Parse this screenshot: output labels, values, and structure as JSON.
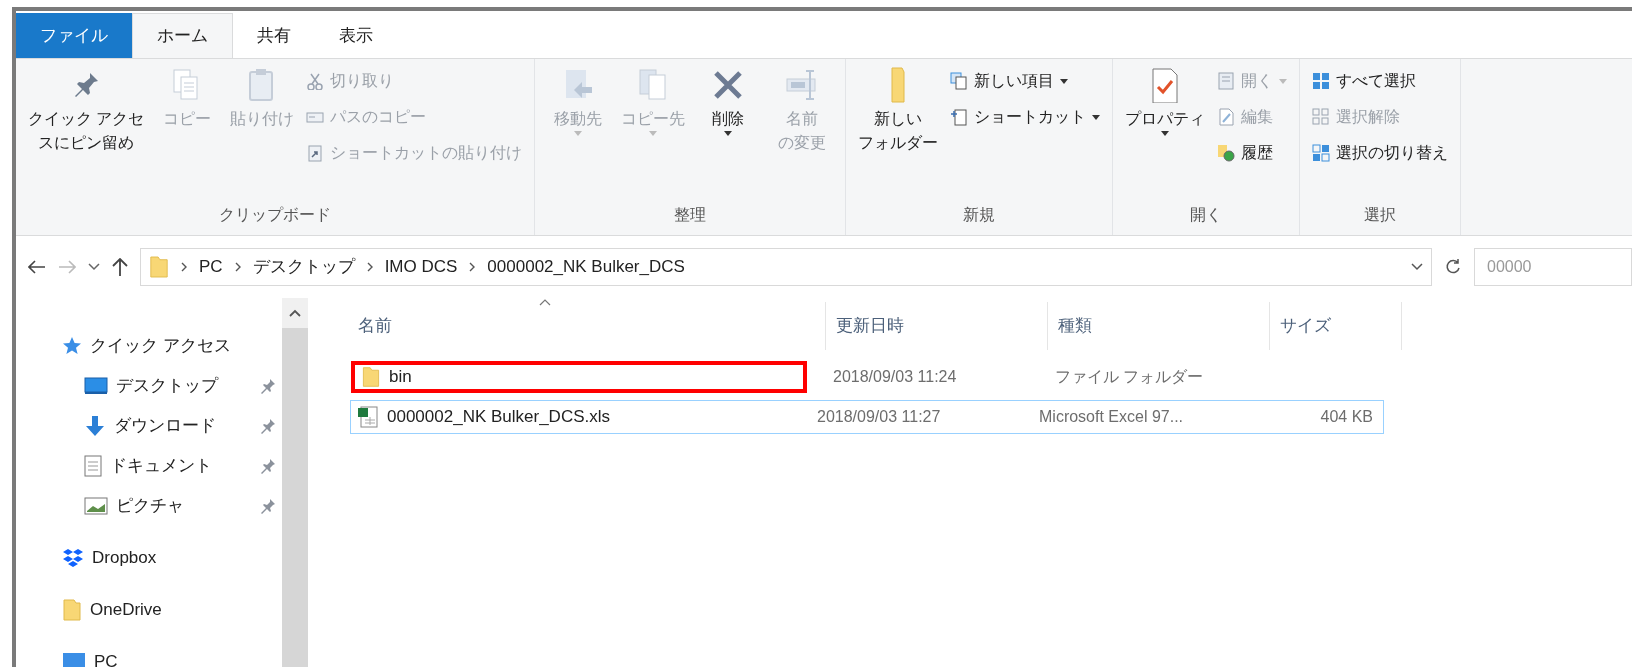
{
  "tabs": [
    {
      "label": "ファイル",
      "kind": "file",
      "selected": false
    },
    {
      "label": "ホーム",
      "kind": "tab",
      "selected": true
    },
    {
      "label": "共有",
      "kind": "tab",
      "selected": false
    },
    {
      "label": "表示",
      "kind": "tab",
      "selected": false
    }
  ],
  "ribbon": [
    {
      "label": "クリップボード",
      "items": [
        {
          "kind": "large",
          "lines": [
            "クイック アクセ",
            "スにピン留め"
          ],
          "disabled": false,
          "dropdown": false
        },
        {
          "kind": "large",
          "label": "コピー",
          "disabled": true,
          "dropdown": false
        },
        {
          "kind": "large",
          "label": "貼り付け",
          "disabled": true,
          "dropdown": false
        },
        {
          "kind": "small",
          "label": "切り取り",
          "disabled": true,
          "dropdown": false
        },
        {
          "kind": "small",
          "label": "パスのコピー",
          "disabled": true,
          "dropdown": false
        },
        {
          "kind": "small",
          "label": "ショートカットの貼り付け",
          "disabled": true,
          "dropdown": false
        }
      ]
    },
    {
      "label": "整理",
      "items": [
        {
          "kind": "large",
          "label": "移動先",
          "disabled": true,
          "dropdown": true
        },
        {
          "kind": "large",
          "label": "コピー先",
          "disabled": true,
          "dropdown": true
        },
        {
          "kind": "large",
          "label": "削除",
          "disabled": false,
          "dropdown": true
        },
        {
          "kind": "large",
          "lines": [
            "名前",
            "の変更"
          ],
          "disabled": true,
          "dropdown": false
        }
      ]
    },
    {
      "label": "新規",
      "items": [
        {
          "kind": "large",
          "lines": [
            "新しい",
            "フォルダー"
          ],
          "disabled": false,
          "dropdown": false
        },
        {
          "kind": "small",
          "label": "新しい項目",
          "disabled": false,
          "dropdown": true
        },
        {
          "kind": "small",
          "label": "ショートカット",
          "disabled": false,
          "dropdown": true
        }
      ]
    },
    {
      "label": "開く",
      "items": [
        {
          "kind": "large",
          "label": "プロパティ",
          "disabled": false,
          "dropdown": true
        },
        {
          "kind": "small",
          "label": "開く",
          "disabled": true,
          "dropdown": true
        },
        {
          "kind": "small",
          "label": "編集",
          "disabled": true,
          "dropdown": false
        },
        {
          "kind": "small",
          "label": "履歴",
          "disabled": false,
          "dropdown": false
        }
      ]
    },
    {
      "label": "選択",
      "items": [
        {
          "kind": "small",
          "label": "すべて選択",
          "disabled": false,
          "dropdown": false
        },
        {
          "kind": "small",
          "label": "選択解除",
          "disabled": true,
          "dropdown": false
        },
        {
          "kind": "small",
          "label": "選択の切り替え",
          "disabled": false,
          "dropdown": false
        }
      ]
    }
  ],
  "address": {
    "path": [
      "PC",
      "デスクトップ",
      "IMO DCS",
      "0000002_NK Bulker_DCS"
    ],
    "search": "00000"
  },
  "sidebar": {
    "items": [
      {
        "label": "クイック アクセス",
        "children": [
          {
            "label": "デスクトップ",
            "pinned": true
          },
          {
            "label": "ダウンロード",
            "pinned": true
          },
          {
            "label": "ドキュメント",
            "pinned": true
          },
          {
            "label": "ピクチャ",
            "pinned": true
          }
        ]
      },
      {
        "label": "Dropbox"
      },
      {
        "label": "OneDrive"
      },
      {
        "label": "PC"
      }
    ]
  },
  "table": {
    "columns": [
      "名前",
      "更新日時",
      "種類",
      "サイズ"
    ],
    "rows": [
      {
        "kind": "folder",
        "name": "bin",
        "modified": "2018/09/03 11:24",
        "type": "ファイル フォルダー",
        "selected": false,
        "highlighted": true
      },
      {
        "kind": "excel",
        "name": "0000002_NK Bulker_DCS.xls",
        "modified": "2018/09/03 11:27",
        "type": "Microsoft Excel 97...",
        "size": "404 KB",
        "selected": true,
        "highlighted": false
      }
    ]
  }
}
